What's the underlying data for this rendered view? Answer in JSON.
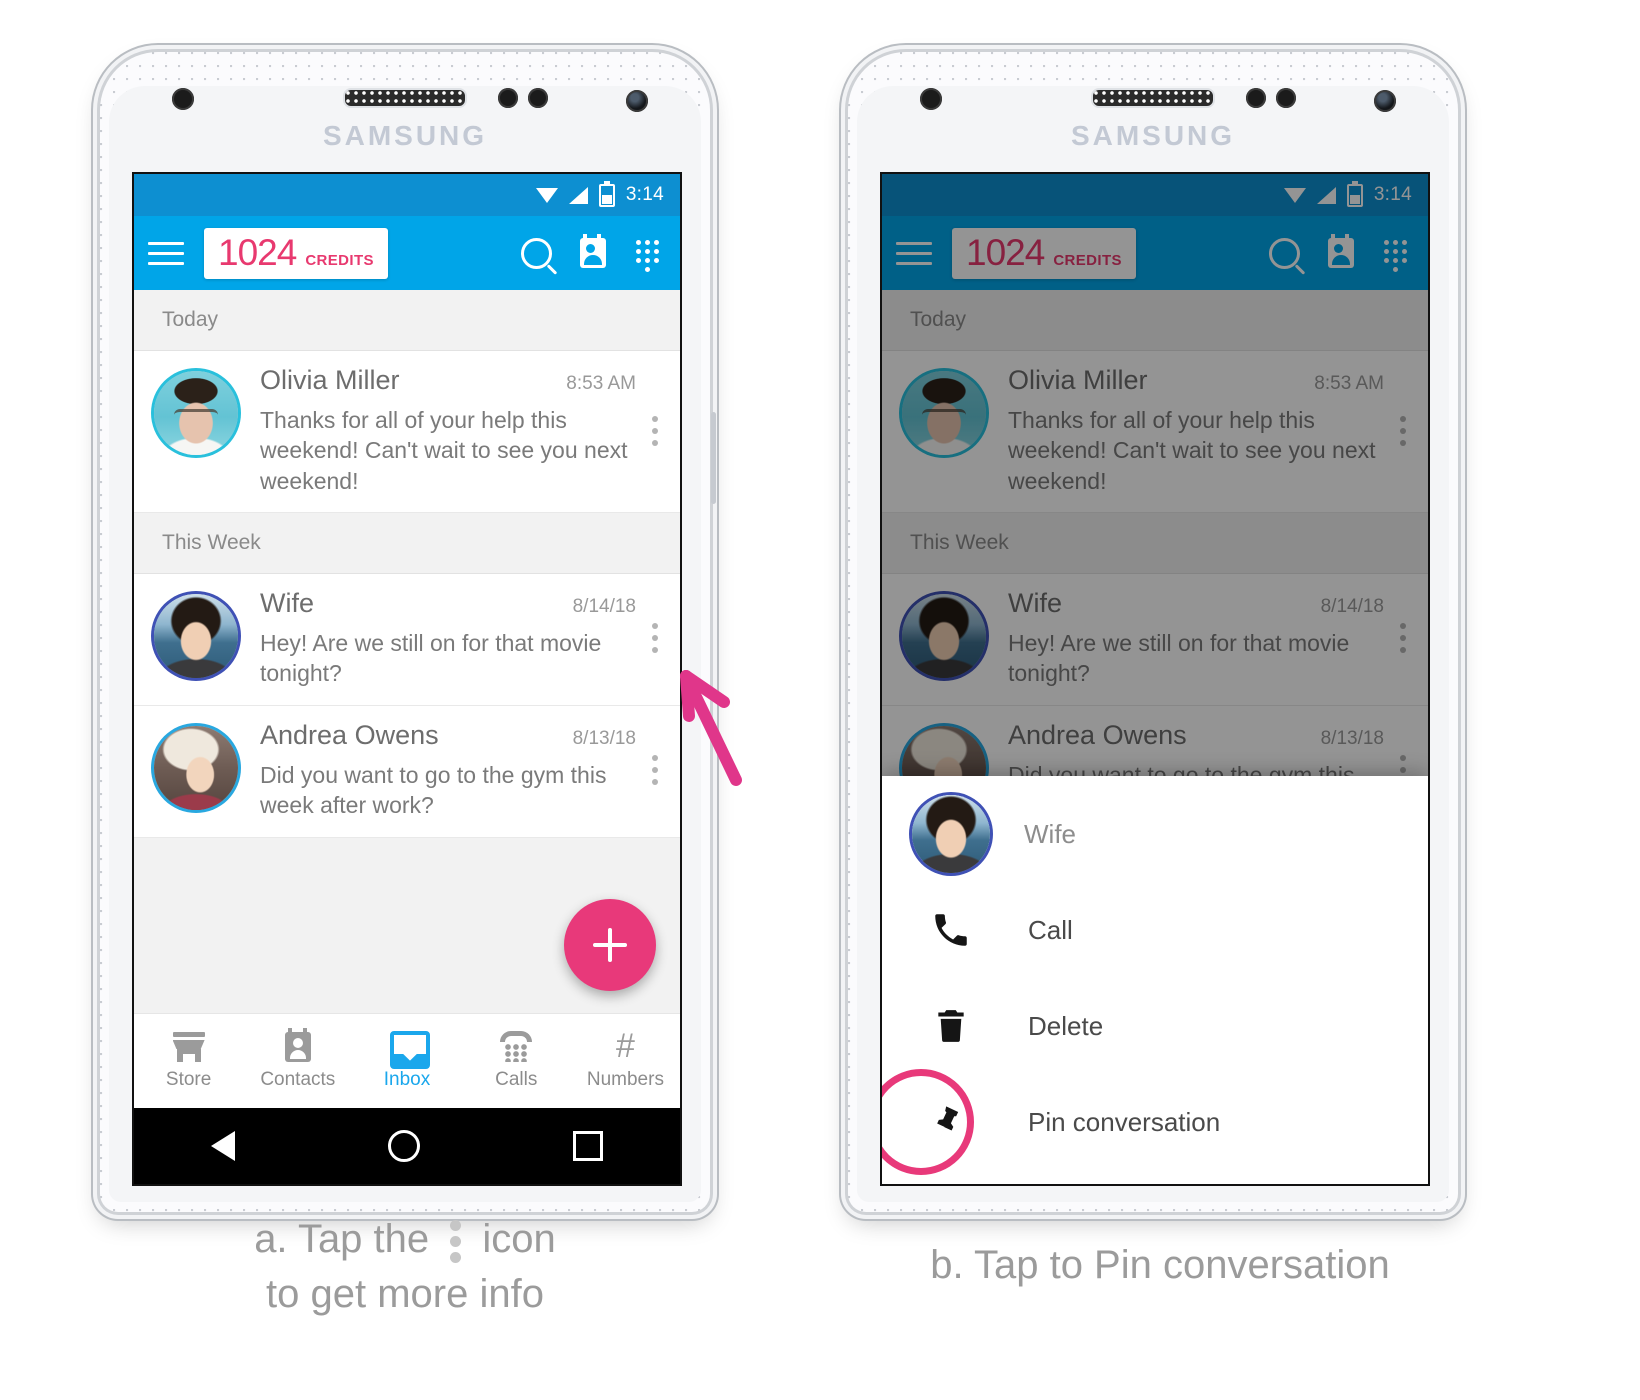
{
  "device": {
    "brand": "SAMSUNG",
    "status_bar": {
      "time": "3:14",
      "icons": [
        "wifi-icon",
        "signal-icon",
        "battery-icon"
      ]
    }
  },
  "app_bar": {
    "menu_icon": "hamburger-menu-icon",
    "credits_value": "1024",
    "credits_label": "CREDITS",
    "actions": [
      "search-icon",
      "contacts-icon",
      "dialpad-icon"
    ]
  },
  "inbox": {
    "sections": [
      {
        "title": "Today",
        "conversations": [
          {
            "name": "Olivia Miller",
            "time": "8:53 AM",
            "message": "Thanks for all of your help this weekend! Can't wait to see you next weekend!",
            "avatar": "olivia-avatar",
            "ring_color": "#29c0dc"
          }
        ]
      },
      {
        "title": "This Week",
        "conversations": [
          {
            "name": "Wife",
            "time": "8/14/18",
            "message": "Hey! Are we still on for that movie tonight?",
            "avatar": "wife-avatar",
            "ring_color": "#3f51b5"
          },
          {
            "name": "Andrea Owens",
            "time": "8/13/18",
            "message": "Did you want to go to the gym this week after work?",
            "avatar": "andrea-avatar",
            "ring_color": "#29a8e0"
          }
        ]
      }
    ],
    "fab_label": "+",
    "overflow_icon": "kebab-menu-icon"
  },
  "bottom_nav": {
    "items": [
      {
        "label": "Store",
        "icon": "store-icon",
        "active": false
      },
      {
        "label": "Contacts",
        "icon": "contacts-icon",
        "active": false
      },
      {
        "label": "Inbox",
        "icon": "inbox-icon",
        "active": true
      },
      {
        "label": "Calls",
        "icon": "calls-icon",
        "active": false
      },
      {
        "label": "Numbers",
        "icon": "hash-icon",
        "active": false
      }
    ],
    "active_color": "#1aa7ec"
  },
  "android_nav": {
    "back": "back-triangle-icon",
    "home": "home-circle-icon",
    "recents": "recents-square-icon"
  },
  "popup_menu": {
    "contact_name": "Wife",
    "items": [
      {
        "label": "Call",
        "icon": "phone-icon"
      },
      {
        "label": "Delete",
        "icon": "trash-icon"
      },
      {
        "label": "Pin conversation",
        "icon": "pin-icon",
        "highlighted": true
      }
    ],
    "highlight_color": "#e8397a"
  },
  "captions": {
    "a_line1_before": "a. Tap the",
    "a_line1_after": "icon",
    "a_line2": "to get more info",
    "b": "b. Tap to Pin conversation"
  },
  "colors": {
    "app_bar": "#00a5e8",
    "status_bar": "#0d8fd1",
    "accent_pink": "#e8397a",
    "credits_pink": "#e8396f"
  }
}
